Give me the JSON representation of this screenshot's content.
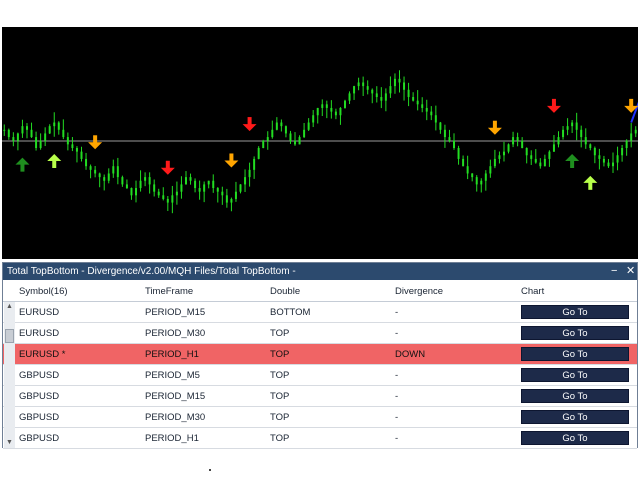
{
  "window": {
    "title": "Total TopBottom - Divergence/v2.00/MQH Files/Total TopBottom -",
    "minimize_glyph": "−",
    "close_glyph": "✕"
  },
  "table": {
    "columns": [
      "Symbol(16)",
      "TimeFrame",
      "Double",
      "Divergence",
      "Chart"
    ],
    "rows": [
      {
        "symbol": "EURUSD",
        "timeframe": "PERIOD_M15",
        "double": "BOTTOM",
        "divergence": "-",
        "button": "Go To",
        "highlight": false
      },
      {
        "symbol": "EURUSD",
        "timeframe": "PERIOD_M30",
        "double": "TOP",
        "divergence": "-",
        "button": "Go To",
        "highlight": false
      },
      {
        "symbol": "EURUSD *",
        "timeframe": "PERIOD_H1",
        "double": "TOP",
        "divergence": "DOWN",
        "button": "Go To",
        "highlight": true
      },
      {
        "symbol": "GBPUSD",
        "timeframe": "PERIOD_M5",
        "double": "TOP",
        "divergence": "-",
        "button": "Go To",
        "highlight": false
      },
      {
        "symbol": "GBPUSD",
        "timeframe": "PERIOD_M15",
        "double": "TOP",
        "divergence": "-",
        "button": "Go To",
        "highlight": false
      },
      {
        "symbol": "GBPUSD",
        "timeframe": "PERIOD_M30",
        "double": "TOP",
        "divergence": "-",
        "button": "Go To",
        "highlight": false
      },
      {
        "symbol": "GBPUSD",
        "timeframe": "PERIOD_H1",
        "double": "TOP",
        "divergence": "-",
        "button": "Go To",
        "highlight": false
      }
    ]
  },
  "colors": {
    "chart_bg": "#000000",
    "candle": "#22dd22",
    "arrow_orange": "#ffa500",
    "arrow_red": "#ff1a1a",
    "arrow_green": "#1f8f1f",
    "arrow_lime": "#b8ff4a",
    "highlight_row": "#f06465",
    "title_bar": "#2c4a6e",
    "button_bg": "#1d2a49"
  },
  "chart_data": {
    "type": "candlestick",
    "series_close": [
      60,
      58,
      57,
      59,
      61,
      60,
      58,
      55,
      57,
      59,
      61,
      62,
      60,
      58,
      56,
      55,
      54,
      52,
      50,
      49,
      48,
      47,
      46,
      48,
      50,
      47,
      45,
      44,
      42,
      44,
      46,
      47,
      45,
      43,
      42,
      41,
      40,
      42,
      43,
      45,
      47,
      46,
      44,
      43,
      45,
      46,
      44,
      43,
      42,
      40,
      41,
      43,
      45,
      47,
      49,
      52,
      55,
      57,
      58,
      60,
      62,
      61,
      59,
      57,
      56,
      58,
      60,
      62,
      64,
      66,
      67,
      66,
      65,
      64,
      66,
      68,
      70,
      72,
      73,
      72,
      71,
      70,
      69,
      68,
      70,
      72,
      74,
      73,
      71,
      69,
      68,
      67,
      66,
      65,
      64,
      62,
      60,
      58,
      57,
      55,
      52,
      50,
      48,
      47,
      45,
      46,
      48,
      50,
      52,
      53,
      54,
      56,
      58,
      57,
      55,
      53,
      52,
      51,
      50,
      52,
      54,
      56,
      58,
      60,
      61,
      62,
      60,
      58,
      56,
      55,
      53,
      52,
      51,
      50,
      51,
      53,
      55,
      57,
      59,
      60
    ],
    "arrows": [
      {
        "kind": "down",
        "color": "orange",
        "index": 20
      },
      {
        "kind": "down",
        "color": "red",
        "index": 36
      },
      {
        "kind": "down",
        "color": "orange",
        "index": 50
      },
      {
        "kind": "down",
        "color": "red",
        "index": 54
      },
      {
        "kind": "down",
        "color": "orange",
        "index": 108
      },
      {
        "kind": "down",
        "color": "red",
        "index": 121
      },
      {
        "kind": "down",
        "color": "orange",
        "index": 138
      },
      {
        "kind": "down",
        "color": "red",
        "index": 146
      },
      {
        "kind": "up",
        "color": "green",
        "index": 4
      },
      {
        "kind": "up",
        "color": "lime",
        "index": 11
      },
      {
        "kind": "up",
        "color": "green",
        "index": 125
      },
      {
        "kind": "up",
        "color": "lime",
        "index": 129
      }
    ],
    "divergence_line": {
      "from_index": 138,
      "to_index": 146
    }
  }
}
